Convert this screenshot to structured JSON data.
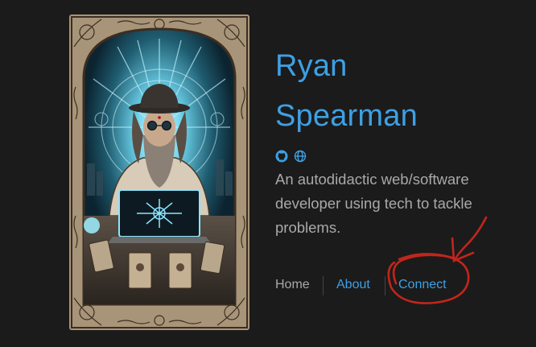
{
  "profile": {
    "name_first": "Ryan",
    "name_last": "Spearman",
    "bio": "An autodidactic web/software developer using tech to tackle problems."
  },
  "social": [
    {
      "icon": "github-icon"
    },
    {
      "icon": "globe-icon"
    }
  ],
  "nav": {
    "home": "Home",
    "about": "About",
    "connect": "Connect"
  },
  "colors": {
    "background": "#1b1b1b",
    "accent": "#3ea0e4",
    "text_muted": "#a9a9a9",
    "annotation": "#c0261c"
  }
}
